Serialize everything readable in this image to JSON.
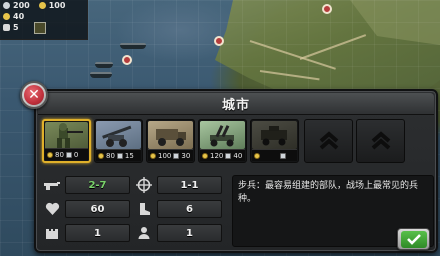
{
  "hud": {
    "silver": "200",
    "gold_top": "100",
    "gold": "40",
    "gear": "5"
  },
  "dialog": {
    "title": "城市",
    "close_icon": "close-icon",
    "confirm_icon": "checkmark-icon",
    "units": [
      {
        "name": "infantry",
        "gold": "80",
        "gear": "0",
        "selected": true,
        "locked": false
      },
      {
        "name": "artillery",
        "gold": "80",
        "gear": "15",
        "selected": false,
        "locked": false
      },
      {
        "name": "truck",
        "gold": "100",
        "gear": "30",
        "selected": false,
        "locked": false
      },
      {
        "name": "anti-aircraft",
        "gold": "120",
        "gear": "40",
        "selected": false,
        "locked": false
      },
      {
        "name": "armored-car",
        "gold": "",
        "gear": "",
        "selected": false,
        "locked": true
      }
    ],
    "stats": {
      "attack": "2-7",
      "range": "1-1",
      "health": "60",
      "movement": "6",
      "defense": "1",
      "personnel": "1"
    },
    "description": "步兵：最容易组建的部队，战场上最常见的兵种。"
  },
  "colors": {
    "accent_gold": "#e0b02a",
    "confirm_green": "#3aa42f",
    "close_red": "#c0303c",
    "attack_green": "#7ad26b"
  }
}
